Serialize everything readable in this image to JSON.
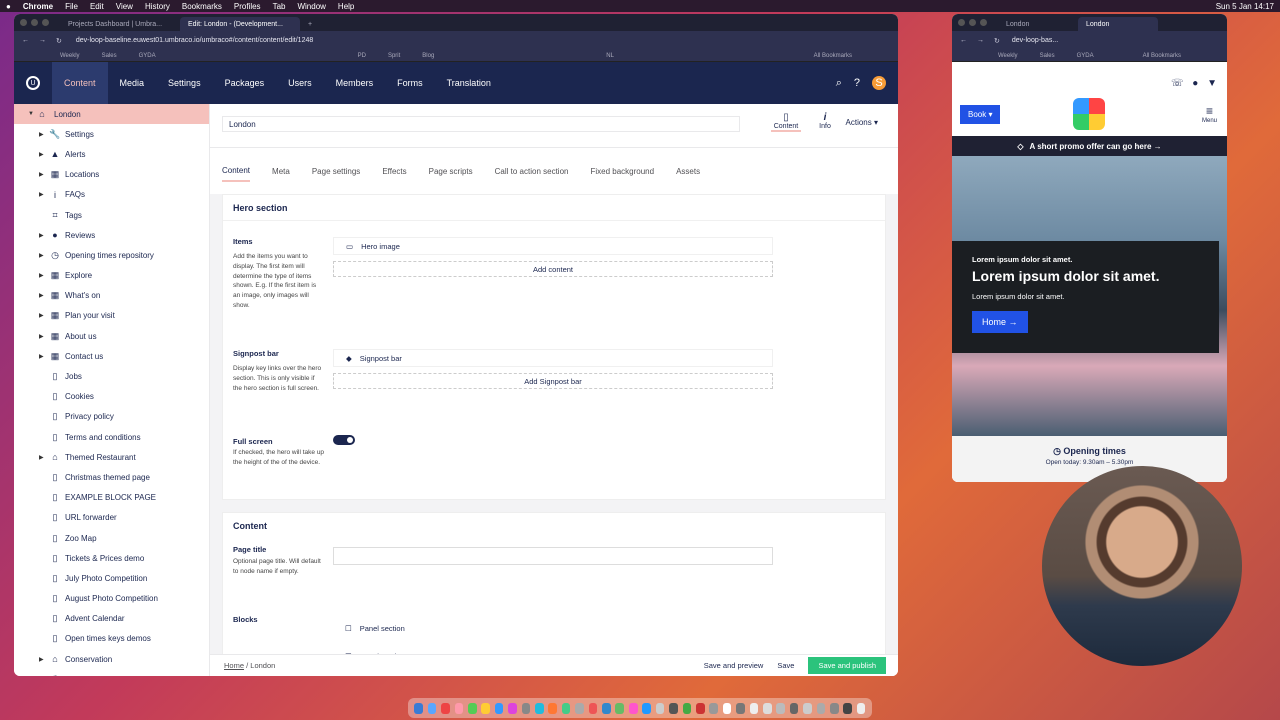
{
  "menubar": {
    "app": "Chrome",
    "items": [
      "File",
      "Edit",
      "View",
      "History",
      "Bookmarks",
      "Profiles",
      "Tab",
      "Window",
      "Help"
    ],
    "clock": "Sun 5 Jan  14:17"
  },
  "main_browser": {
    "tabs": [
      "Projects Dashboard | Umbra...",
      "Edit: London - (Development..."
    ],
    "url": "dev-loop-baseline.euwest01.umbraco.io/umbraco#/content/content/edit/1248",
    "bookmarks": [
      "Weekly",
      "Sales",
      "GYDA",
      "PD",
      "Sprit",
      "Blog",
      "NL",
      "All Bookmarks"
    ]
  },
  "umbraco": {
    "logo": "U",
    "sections": [
      "Content",
      "Media",
      "Settings",
      "Packages",
      "Users",
      "Members",
      "Forms",
      "Translation"
    ],
    "active_section": "Content",
    "avatar": "S",
    "tree": [
      {
        "label": "London",
        "icon": "home-icon",
        "arrow": "▼",
        "active": true
      },
      {
        "label": "Settings",
        "icon": "wrench-icon",
        "arrow": "▶"
      },
      {
        "label": "Alerts",
        "icon": "warning-icon",
        "arrow": "▶"
      },
      {
        "label": "Locations",
        "icon": "grid-icon",
        "arrow": "▶"
      },
      {
        "label": "FAQs",
        "icon": "info-icon",
        "arrow": "▶"
      },
      {
        "label": "Tags",
        "icon": "tag-icon",
        "arrow": ""
      },
      {
        "label": "Reviews",
        "icon": "chat-icon",
        "arrow": "▶"
      },
      {
        "label": "Opening times repository",
        "icon": "clock-icon",
        "arrow": "▶"
      },
      {
        "label": "Explore",
        "icon": "grid-icon",
        "arrow": "▶"
      },
      {
        "label": "What's on",
        "icon": "grid-icon",
        "arrow": "▶"
      },
      {
        "label": "Plan your visit",
        "icon": "grid-icon",
        "arrow": "▶"
      },
      {
        "label": "About us",
        "icon": "grid-icon",
        "arrow": "▶"
      },
      {
        "label": "Contact us",
        "icon": "grid-icon",
        "arrow": "▶"
      },
      {
        "label": "Jobs",
        "icon": "document-icon",
        "arrow": ""
      },
      {
        "label": "Cookies",
        "icon": "document-icon",
        "arrow": ""
      },
      {
        "label": "Privacy policy",
        "icon": "document-icon",
        "arrow": ""
      },
      {
        "label": "Terms and conditions",
        "icon": "document-icon",
        "arrow": ""
      },
      {
        "label": "Themed Restaurant",
        "icon": "home-icon",
        "arrow": "▶"
      },
      {
        "label": "Christmas themed page",
        "icon": "document-icon",
        "arrow": ""
      },
      {
        "label": "EXAMPLE BLOCK PAGE",
        "icon": "document-icon",
        "arrow": ""
      },
      {
        "label": "URL forwarder",
        "icon": "document-icon",
        "arrow": ""
      },
      {
        "label": "Zoo Map",
        "icon": "document-icon",
        "arrow": ""
      },
      {
        "label": "Tickets & Prices demo",
        "icon": "document-icon",
        "arrow": ""
      },
      {
        "label": "July Photo Competition",
        "icon": "document-icon",
        "arrow": ""
      },
      {
        "label": "August Photo Competition",
        "icon": "document-icon",
        "arrow": ""
      },
      {
        "label": "Advent Calendar",
        "icon": "document-icon",
        "arrow": ""
      },
      {
        "label": "Open times keys demos",
        "icon": "document-icon",
        "arrow": ""
      },
      {
        "label": "Conservation",
        "icon": "home-icon",
        "arrow": "▶"
      },
      {
        "label": "Recycle Bin",
        "icon": "trash-icon",
        "arrow": "▶"
      }
    ],
    "node_name": "London",
    "apps": [
      "Content",
      "Info"
    ],
    "actions": "Actions",
    "content_tabs": [
      "Content",
      "Meta",
      "Page settings",
      "Effects",
      "Page scripts",
      "Call to action section",
      "Fixed background",
      "Assets"
    ],
    "hero": {
      "title": "Hero section",
      "items_label": "Items",
      "items_desc": "Add the items you want to display. The first item will determine the type of items shown. E.g. If the first item is an image, only images will show.",
      "hero_image": "Hero image",
      "add_content": "Add content",
      "signpost_label": "Signpost bar",
      "signpost_desc": "Display key links over the hero section. This is only visible if the hero section is full screen.",
      "signpost_item": "Signpost bar",
      "add_signpost": "Add Signpost bar",
      "fullscreen_label": "Full screen",
      "fullscreen_desc": "If checked, the hero will take up the height of the of the device.",
      "fullscreen_on": true
    },
    "content": {
      "title": "Content",
      "page_title_label": "Page title",
      "page_title_desc": "Optional page title. Will default to node name if empty.",
      "blocks_label": "Blocks",
      "blocks": [
        "Panel section",
        "Panel section"
      ]
    },
    "footer": {
      "breadcrumb": [
        "Home",
        "London"
      ],
      "save_preview": "Save and preview",
      "save": "Save",
      "save_publish": "Save and publish"
    }
  },
  "preview_browser": {
    "tabs": [
      "London",
      "London"
    ],
    "url": "dev-loop-bas...",
    "bookmarks": [
      "Weekly",
      "Sales",
      "GYDA",
      "All Bookmarks"
    ],
    "site": {
      "book": "Book",
      "menu": "Menu",
      "promo": "A short promo offer can go here →",
      "hero_sub": "Lorem ipsum dolor sit amet.",
      "hero_title": "Lorem ipsum dolor sit amet.",
      "hero_text": "Lorem ipsum dolor sit amet.",
      "hero_button": "Home →",
      "opening_title": "Opening times",
      "opening_sub": "Open today: 9.30am – 5.30pm"
    }
  },
  "colors": {
    "umbraco_nav": "#1b264f",
    "active_pink": "#f5c1bc",
    "publish_green": "#2bc37c",
    "site_blue": "#2152e5"
  }
}
